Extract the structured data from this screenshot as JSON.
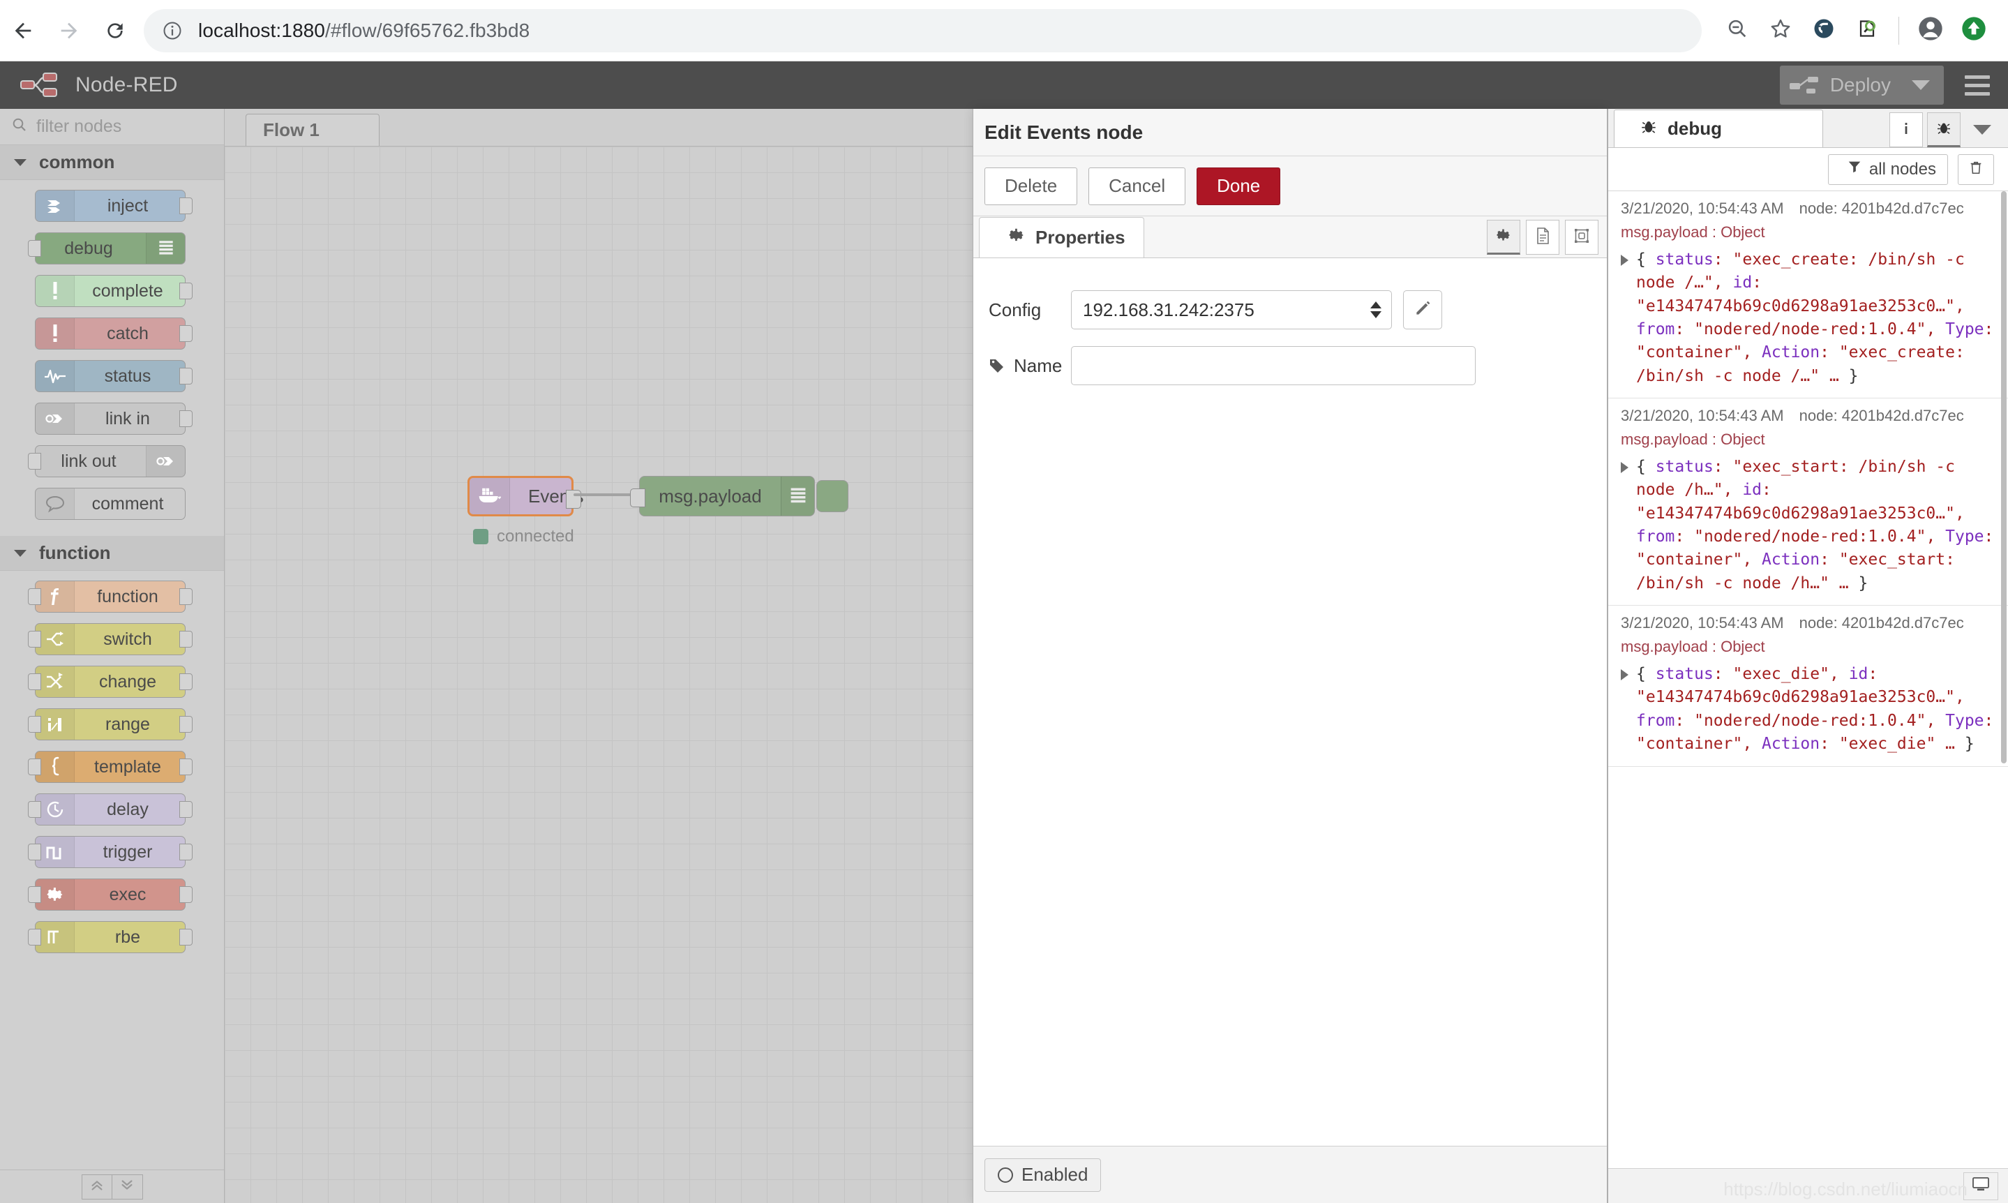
{
  "browser": {
    "url_host": "localhost:1880",
    "url_path": "/#flow/69f65762.fb3bd8",
    "back_icon": "back-arrow-icon",
    "forward_icon": "forward-arrow-icon",
    "reload_icon": "reload-icon",
    "info_icon": "site-info-icon",
    "zoom_out_icon": "zoom-out-icon",
    "bookmark_icon": "star-icon",
    "ext1_icon": "extension-icon",
    "ext2_icon": "search-document-icon",
    "profile_icon": "profile-avatar-icon",
    "update_icon": "update-available-icon"
  },
  "header": {
    "title": "Node-RED",
    "logo_icon": "node-red-logo-icon",
    "deploy_label": "Deploy",
    "deploy_icon": "deploy-icon",
    "deploy_caret_icon": "chevron-down-icon",
    "menu_icon": "hamburger-menu-icon"
  },
  "palette": {
    "search_placeholder": "filter nodes",
    "search_icon": "search-icon",
    "collapse_all_icon": "chevron-double-up-icon",
    "expand_all_icon": "chevron-double-down-icon",
    "categories": [
      {
        "name": "common",
        "nodes": [
          {
            "label": "inject",
            "icon": "inject-arrow-icon",
            "color": "#a6bbcf",
            "ports": "out"
          },
          {
            "label": "debug",
            "icon": "debug-lines-icon",
            "color": "#87a980",
            "ports": "in",
            "ribbon": true
          },
          {
            "label": "complete",
            "icon": "exclamation-icon",
            "color": "#c0dfc0",
            "ports": "out"
          },
          {
            "label": "catch",
            "icon": "exclamation-icon",
            "color": "#d1a0a0",
            "ports": "out"
          },
          {
            "label": "status",
            "icon": "pulse-icon",
            "color": "#9fb6c4",
            "ports": "out"
          },
          {
            "label": "link in",
            "icon": "link-arrow-icon",
            "color": "#c7c7c7",
            "ports": "out"
          },
          {
            "label": "link out",
            "icon": "link-arrow-icon",
            "color": "#c7c7c7",
            "ports": "in",
            "ribbon": true
          },
          {
            "label": "comment",
            "icon": "comment-bubble-icon",
            "color": "#cdcdcd",
            "ports": "none"
          }
        ]
      },
      {
        "name": "function",
        "nodes": [
          {
            "label": "function",
            "icon": "function-f-icon",
            "color": "#e3bfa4",
            "ports": "both"
          },
          {
            "label": "switch",
            "icon": "switch-branch-icon",
            "color": "#d2ce84",
            "ports": "both"
          },
          {
            "label": "change",
            "icon": "change-swap-icon",
            "color": "#d2ce84",
            "ports": "both"
          },
          {
            "label": "range",
            "icon": "range-bars-icon",
            "color": "#d2ce84",
            "ports": "both"
          },
          {
            "label": "template",
            "icon": "template-brace-icon",
            "color": "#dcac71",
            "ports": "both"
          },
          {
            "label": "delay",
            "icon": "delay-clock-icon",
            "color": "#c9c2d8",
            "ports": "both"
          },
          {
            "label": "trigger",
            "icon": "trigger-pulse-icon",
            "color": "#c9c2d8",
            "ports": "both"
          },
          {
            "label": "exec",
            "icon": "gear-icon",
            "color": "#d1948c",
            "ports": "both"
          },
          {
            "label": "rbe",
            "icon": "rbe-step-icon",
            "color": "#d2ce84",
            "ports": "both"
          }
        ]
      }
    ]
  },
  "workspace": {
    "tabs": [
      {
        "label": "Flow 1"
      }
    ],
    "nodes": [
      {
        "label": "Events",
        "icon": "docker-whale-icon",
        "color": "#c9b5cf",
        "selected": true,
        "status_label": "connected",
        "status_color": "#6f9e84"
      },
      {
        "label": "msg.payload",
        "icon": "debug-lines-icon",
        "color": "#8aa883",
        "selected": false
      }
    ]
  },
  "dialog": {
    "title": "Edit Events node",
    "delete_label": "Delete",
    "cancel_label": "Cancel",
    "done_label": "Done",
    "tab_label": "Properties",
    "tab_icon": "gear-icon",
    "icon_buttons": [
      {
        "name": "properties-icon",
        "active": true
      },
      {
        "name": "description-document-icon",
        "active": false
      },
      {
        "name": "appearance-icon",
        "active": false
      }
    ],
    "fields": {
      "config_label": "Config",
      "config_value": "192.168.31.242:2375",
      "config_edit_icon": "pencil-edit-icon",
      "name_label": "Name",
      "name_icon": "tag-icon",
      "name_value": "",
      "name_placeholder": ""
    },
    "footer": {
      "enabled_label": "Enabled",
      "enabled_icon": "circle-toggle-icon"
    }
  },
  "sidebar": {
    "tab_label": "debug",
    "tab_icon": "bug-icon",
    "info_button_icon": "info-icon",
    "debug_button_icon": "bug-icon",
    "caret_icon": "chevron-down-icon",
    "filter_label": "all nodes",
    "filter_icon": "funnel-icon",
    "clear_icon": "trash-icon",
    "footer_icon": "monitor-icon",
    "watermark": "https://blog.csdn.net/liumiaocn",
    "messages": [
      {
        "timestamp": "3/21/2020, 10:54:43 AM",
        "node": "node: 4201b42d.d7c7ec",
        "topic": "msg.payload : Object",
        "parts": [
          {
            "t": "brc",
            "v": "{ "
          },
          {
            "t": "k",
            "v": "status"
          },
          {
            "t": "p",
            "v": ": "
          },
          {
            "t": "v",
            "v": "\"exec_create: /bin/sh -c node /…\""
          },
          {
            "t": "p",
            "v": ", "
          },
          {
            "t": "k",
            "v": "id"
          },
          {
            "t": "p",
            "v": ": "
          },
          {
            "t": "v",
            "v": "\"e14347474b69c0d6298a91ae3253c0…\""
          },
          {
            "t": "p",
            "v": ", "
          },
          {
            "t": "k",
            "v": "from"
          },
          {
            "t": "p",
            "v": ": "
          },
          {
            "t": "v",
            "v": "\"nodered/node-red:1.0.4\""
          },
          {
            "t": "p",
            "v": ", "
          },
          {
            "t": "k",
            "v": "Type"
          },
          {
            "t": "p",
            "v": ": "
          },
          {
            "t": "v",
            "v": "\"container\""
          },
          {
            "t": "p",
            "v": ", "
          },
          {
            "t": "k",
            "v": "Action"
          },
          {
            "t": "p",
            "v": ": "
          },
          {
            "t": "v",
            "v": "\"exec_create: /bin/sh -c node /…\""
          },
          {
            "t": "p",
            "v": " … "
          },
          {
            "t": "brc",
            "v": "}"
          }
        ]
      },
      {
        "timestamp": "3/21/2020, 10:54:43 AM",
        "node": "node: 4201b42d.d7c7ec",
        "topic": "msg.payload : Object",
        "parts": [
          {
            "t": "brc",
            "v": "{ "
          },
          {
            "t": "k",
            "v": "status"
          },
          {
            "t": "p",
            "v": ": "
          },
          {
            "t": "v",
            "v": "\"exec_start: /bin/sh -c node /h…\""
          },
          {
            "t": "p",
            "v": ", "
          },
          {
            "t": "k",
            "v": "id"
          },
          {
            "t": "p",
            "v": ": "
          },
          {
            "t": "v",
            "v": "\"e14347474b69c0d6298a91ae3253c0…\""
          },
          {
            "t": "p",
            "v": ", "
          },
          {
            "t": "k",
            "v": "from"
          },
          {
            "t": "p",
            "v": ": "
          },
          {
            "t": "v",
            "v": "\"nodered/node-red:1.0.4\""
          },
          {
            "t": "p",
            "v": ", "
          },
          {
            "t": "k",
            "v": "Type"
          },
          {
            "t": "p",
            "v": ": "
          },
          {
            "t": "v",
            "v": "\"container\""
          },
          {
            "t": "p",
            "v": ", "
          },
          {
            "t": "k",
            "v": "Action"
          },
          {
            "t": "p",
            "v": ": "
          },
          {
            "t": "v",
            "v": "\"exec_start: /bin/sh -c node /h…\""
          },
          {
            "t": "p",
            "v": " … "
          },
          {
            "t": "brc",
            "v": "}"
          }
        ]
      },
      {
        "timestamp": "3/21/2020, 10:54:43 AM",
        "node": "node: 4201b42d.d7c7ec",
        "topic": "msg.payload : Object",
        "parts": [
          {
            "t": "brc",
            "v": "{ "
          },
          {
            "t": "k",
            "v": "status"
          },
          {
            "t": "p",
            "v": ": "
          },
          {
            "t": "v",
            "v": "\"exec_die\""
          },
          {
            "t": "p",
            "v": ", "
          },
          {
            "t": "k",
            "v": "id"
          },
          {
            "t": "p",
            "v": ": "
          },
          {
            "t": "v",
            "v": "\"e14347474b69c0d6298a91ae3253c0…\""
          },
          {
            "t": "p",
            "v": ", "
          },
          {
            "t": "k",
            "v": "from"
          },
          {
            "t": "p",
            "v": ": "
          },
          {
            "t": "v",
            "v": "\"nodered/node-red:1.0.4\""
          },
          {
            "t": "p",
            "v": ", "
          },
          {
            "t": "k",
            "v": "Type"
          },
          {
            "t": "p",
            "v": ": "
          },
          {
            "t": "v",
            "v": "\"container\""
          },
          {
            "t": "p",
            "v": ", "
          },
          {
            "t": "k",
            "v": "Action"
          },
          {
            "t": "p",
            "v": ": "
          },
          {
            "t": "v",
            "v": "\"exec_die\""
          },
          {
            "t": "p",
            "v": " … "
          },
          {
            "t": "brc",
            "v": "}"
          }
        ]
      }
    ]
  }
}
